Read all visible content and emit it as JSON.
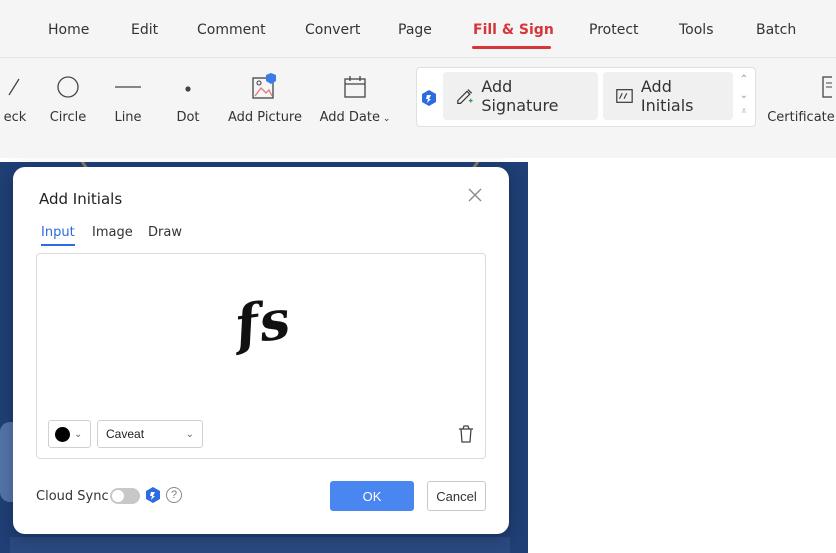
{
  "menu": {
    "items": [
      "Home",
      "Edit",
      "Comment",
      "Convert",
      "Page",
      "Fill & Sign",
      "Protect",
      "Tools",
      "Batch"
    ],
    "active": "Fill & Sign"
  },
  "toolbar": {
    "check_label": "eck",
    "circle_label": "Circle",
    "line_label": "Line",
    "dot_label": "Dot",
    "add_picture_label": "Add Picture",
    "add_date_label": "Add Date",
    "add_signature_label": "Add Signature",
    "add_initials_label": "Add Initials",
    "certificate_label": "Certificate"
  },
  "dialog": {
    "title": "Add Initials",
    "tabs": [
      "Input",
      "Image",
      "Draw"
    ],
    "active_tab": "Input",
    "initials_text": "fs",
    "color": "#000000",
    "font": "Caveat",
    "cloud_sync_label": "Cloud Sync",
    "cloud_sync_on": false,
    "ok_label": "OK",
    "cancel_label": "Cancel"
  },
  "colors": {
    "accent": "#d6353b",
    "primary_button": "#4a86f0",
    "active_tab": "#2d6be0",
    "document_bg": "#1f3f75"
  }
}
